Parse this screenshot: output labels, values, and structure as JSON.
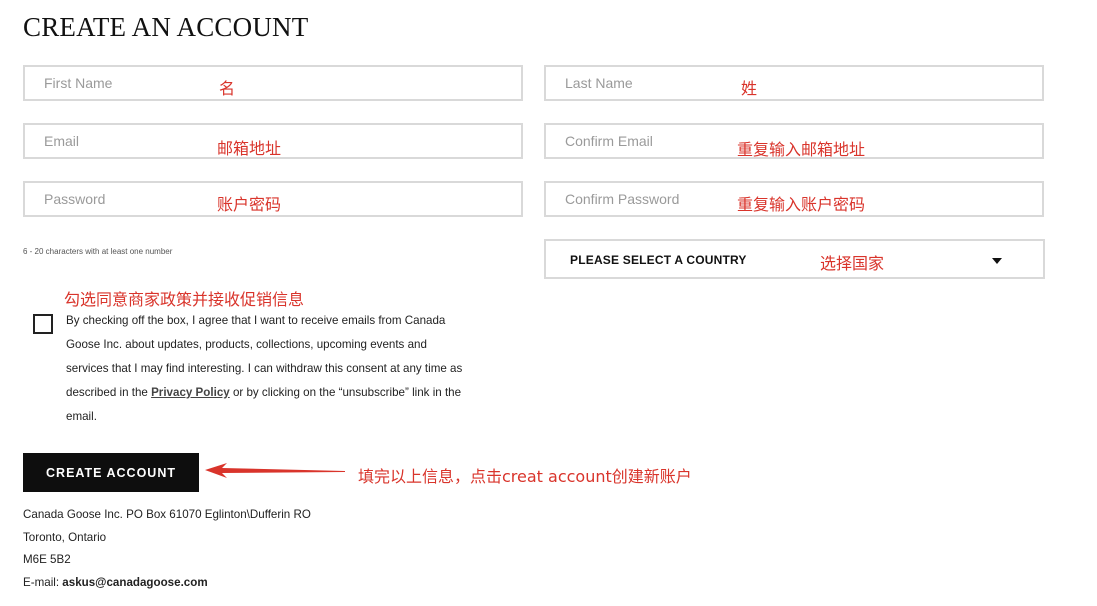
{
  "page_title": "CREATE AN ACCOUNT",
  "fields": {
    "first_name": {
      "placeholder": "First Name",
      "note": "名"
    },
    "last_name": {
      "placeholder": "Last Name",
      "note": "姓"
    },
    "email": {
      "placeholder": "Email",
      "note": "邮箱地址"
    },
    "confirm_email": {
      "placeholder": "Confirm Email",
      "note": "重复输入邮箱地址"
    },
    "password": {
      "placeholder": "Password",
      "note": "账户密码"
    },
    "confirm_password": {
      "placeholder": "Confirm Password",
      "note": "重复输入账户密码"
    }
  },
  "password_hint": "6 - 20 characters with at least one number",
  "country": {
    "label": "PLEASE SELECT A COUNTRY",
    "note": "选择国家",
    "icon": "caret-down-icon"
  },
  "consent": {
    "note": "勾选同意商家政策并接收促销信息",
    "text_before": "By checking off the box, I agree that I want to receive emails from Canada Goose Inc. about updates, products, collections, upcoming events and services that I may find interesting. I can withdraw this consent at any time as described in the ",
    "link": "Privacy Policy",
    "text_after": " or by clicking on the “unsubscribe” link in the email."
  },
  "create_button": {
    "label": "CREATE ACCOUNT",
    "note": "填完以上信息，点击creat account创建新账户"
  },
  "annotation_color": "#d9342b",
  "address": {
    "line1": "Canada Goose Inc. PO Box 61070 Eglinton\\Dufferin RO",
    "line2": "Toronto, Ontario",
    "line3": "M6E 5B2",
    "email_label": "E-mail: ",
    "email": "askus@canadagoose.com"
  }
}
